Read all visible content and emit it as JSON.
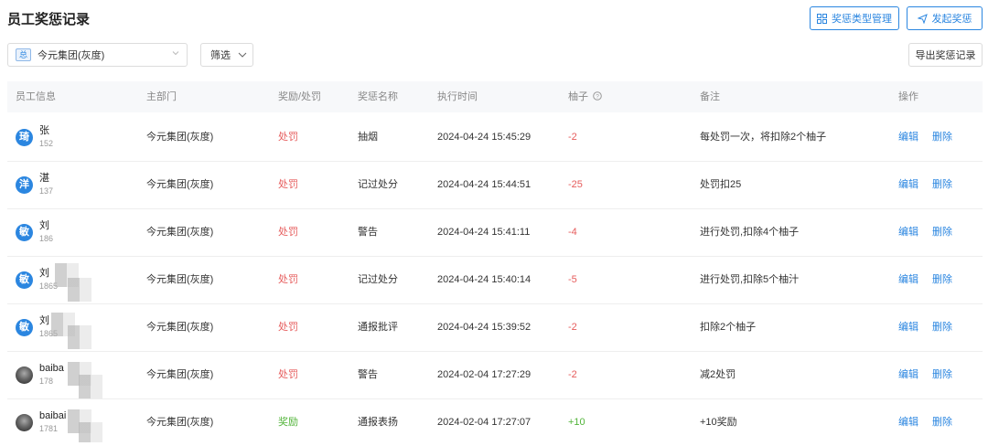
{
  "page": {
    "title": "员工奖惩记录"
  },
  "toolbar": {
    "type_manage_label": "奖惩类型管理",
    "issue_label": "发起奖惩",
    "export_label": "导出奖惩记录"
  },
  "filters": {
    "org_tag": "总",
    "org_value": "今元集团(灰度)",
    "filter_label": "筛选"
  },
  "table": {
    "headers": [
      "员工信息",
      "主部门",
      "奖励/处罚",
      "奖惩名称",
      "执行时间",
      "柚子",
      "备注",
      "操作"
    ],
    "rows": [
      {
        "avatar": "琦",
        "name": "张",
        "phone": "152",
        "dept": "今元集团(灰度)",
        "kind": "处罚",
        "item": "抽烟",
        "time": "2024-04-24 15:45:29",
        "points": "-2",
        "note": "每处罚一次，将扣除2个柚子",
        "edit": "编辑",
        "del": "删除"
      },
      {
        "avatar": "洋",
        "name": "湛",
        "phone": "137",
        "dept": "今元集团(灰度)",
        "kind": "处罚",
        "item": "记过处分",
        "time": "2024-04-24 15:44:51",
        "points": "-25",
        "note": "处罚扣25",
        "edit": "编辑",
        "del": "删除"
      },
      {
        "avatar": "敏",
        "name": "刘",
        "phone": "186",
        "dept": "今元集团(灰度)",
        "kind": "处罚",
        "item": "警告",
        "time": "2024-04-24 15:41:11",
        "points": "-4",
        "note": "进行处罚,扣除4个柚子",
        "edit": "编辑",
        "del": "删除"
      },
      {
        "avatar": "敏",
        "name": "刘",
        "phone": "1865",
        "dept": "今元集团(灰度)",
        "kind": "处罚",
        "item": "记过处分",
        "time": "2024-04-24 15:40:14",
        "points": "-5",
        "note": "进行处罚,扣除5个柚汁",
        "edit": "编辑",
        "del": "删除"
      },
      {
        "avatar": "敏",
        "name": "刘",
        "phone": "1865",
        "dept": "今元集团(灰度)",
        "kind": "处罚",
        "item": "通报批评",
        "time": "2024-04-24 15:39:52",
        "points": "-2",
        "note": "扣除2个柚子",
        "edit": "编辑",
        "del": "删除"
      },
      {
        "avatar": "",
        "name": "baiba",
        "phone": "178",
        "dept": "今元集团(灰度)",
        "kind": "处罚",
        "item": "警告",
        "time": "2024-02-04 17:27:29",
        "points": "-2",
        "note": "减2处罚",
        "edit": "编辑",
        "del": "删除"
      },
      {
        "avatar": "",
        "name": "baibai",
        "phone": "1781",
        "dept": "今元集团(灰度)",
        "kind": "奖励",
        "item": "通报表扬",
        "time": "2024-02-04 17:27:07",
        "points": "+10",
        "note": "+10奖励",
        "edit": "编辑",
        "del": "删除"
      }
    ]
  }
}
